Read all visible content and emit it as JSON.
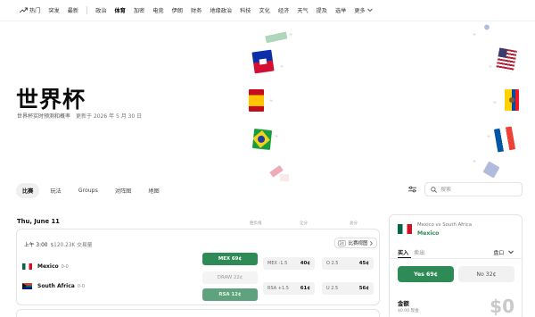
{
  "nav": {
    "items": [
      {
        "label": "热门",
        "active": false,
        "icon": "trend-icon"
      },
      {
        "label": "突发",
        "active": false
      },
      {
        "label": "最新",
        "active": false
      }
    ],
    "categories": [
      {
        "label": "政治",
        "active": false
      },
      {
        "label": "体育",
        "active": true
      },
      {
        "label": "加密",
        "active": false
      },
      {
        "label": "电竞",
        "active": false
      },
      {
        "label": "伊朗",
        "active": false
      },
      {
        "label": "财务",
        "active": false
      },
      {
        "label": "地缘政治",
        "active": false
      },
      {
        "label": "科技",
        "active": false
      },
      {
        "label": "文化",
        "active": false
      },
      {
        "label": "经济",
        "active": false
      },
      {
        "label": "天气",
        "active": false
      },
      {
        "label": "提及",
        "active": false
      },
      {
        "label": "选举",
        "active": false
      },
      {
        "label": "更多",
        "active": false
      }
    ]
  },
  "hero": {
    "title": "世界杯",
    "subtitle": "世界杯实时预测和概率",
    "updated": "更新于 2026 年 5 月 30 日"
  },
  "tabs": [
    "比赛",
    "玩法",
    "Groups",
    "对阵图",
    "地图"
  ],
  "active_tab": "比赛",
  "search": {
    "placeholder": "搜索"
  },
  "schedule": {
    "day": "Thu, June 11",
    "columns": {
      "moneyline": "胜负线",
      "spread": "让分",
      "total": "总分"
    }
  },
  "match": {
    "kickoff": "上午 3:00",
    "volume": "$120.23K 交易量",
    "view_label": "比赛视图",
    "view_badge": "24",
    "home": {
      "name": "Mexico",
      "record": "0-0"
    },
    "away": {
      "name": "South Africa",
      "record": "0-0"
    },
    "moneyline": {
      "home": "MEX 69¢",
      "draw": "DRAW 22¢",
      "away": "RSA 12¢"
    },
    "spread": {
      "home": {
        "label": "MEX -1.5",
        "price": "40¢"
      },
      "away": {
        "label": "RSA +1.5",
        "price": "61¢"
      }
    },
    "total": {
      "over": {
        "label": "O 2.5",
        "price": "45¢"
      },
      "under": {
        "label": "U 2.5",
        "price": "56¢"
      }
    }
  },
  "panel": {
    "match": "Mexico vs South Africa",
    "pick": "Mexico",
    "buy": "买入",
    "sell": "卖出",
    "order_type": "盘口",
    "yes": "Yes 69¢",
    "no": "No 32¢",
    "amount_label": "金额",
    "cash": "$0.00 现金",
    "amount_value": "$0"
  },
  "colors": {
    "accent_green": "#2f8b55",
    "no_gray": "#f1f1f1"
  }
}
